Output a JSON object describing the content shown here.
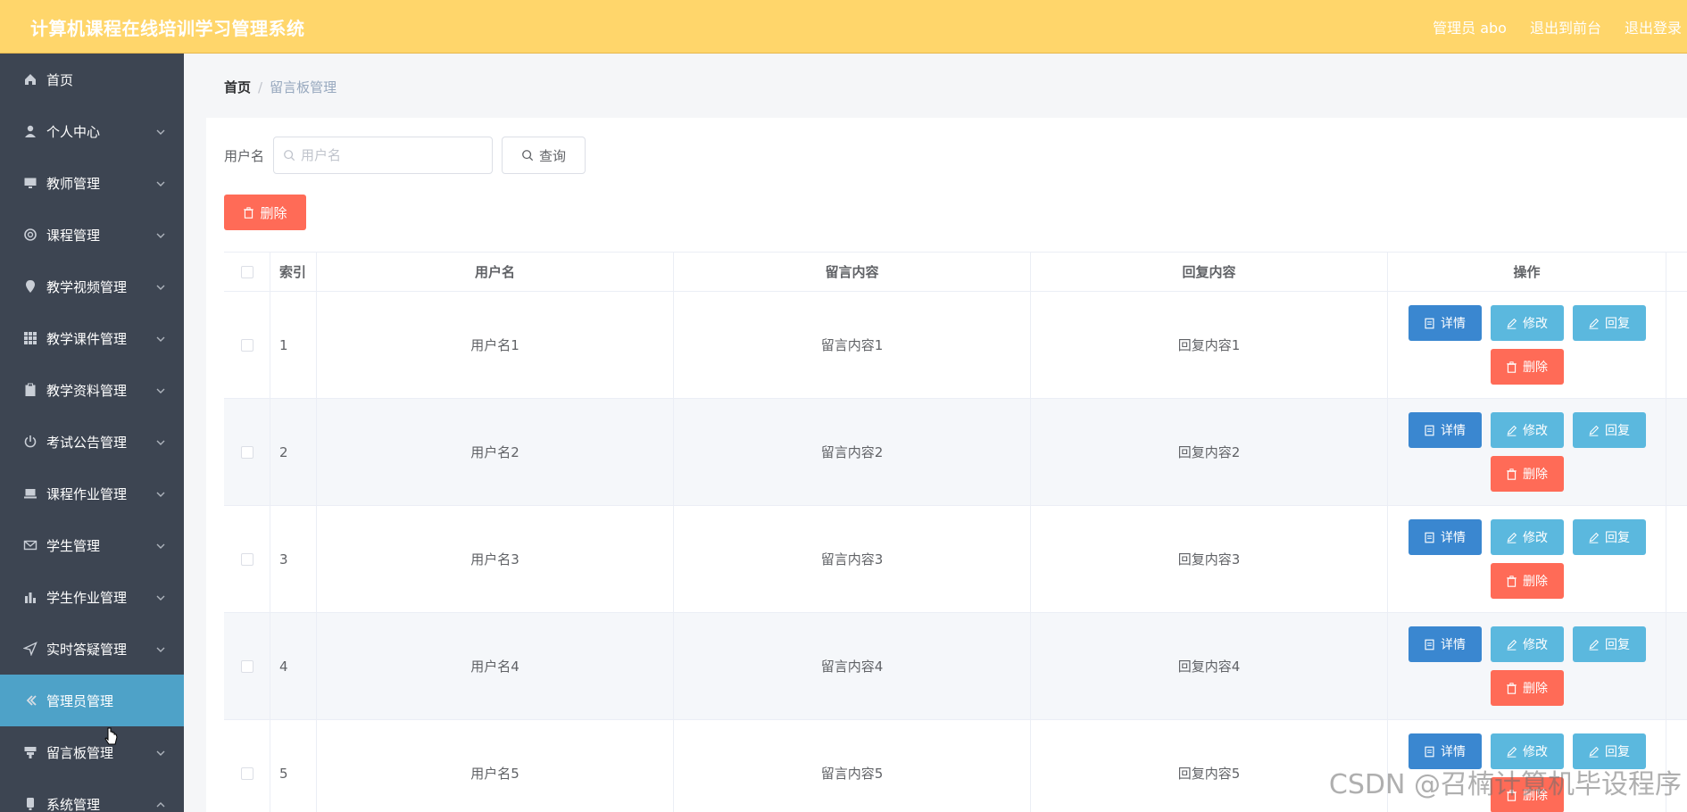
{
  "header": {
    "title": "计算机课程在线培训学习管理系统",
    "admin": "管理员 abo",
    "to_front": "退出到前台",
    "logout": "退出登录"
  },
  "sidebar": {
    "items": [
      {
        "label": "首页",
        "icon": "home-icon"
      },
      {
        "label": "个人中心",
        "icon": "user-icon"
      },
      {
        "label": "教师管理",
        "icon": "monitor-icon"
      },
      {
        "label": "课程管理",
        "icon": "lifebuoy-icon"
      },
      {
        "label": "教学视频管理",
        "icon": "location-icon"
      },
      {
        "label": "教学课件管理",
        "icon": "grid-icon"
      },
      {
        "label": "教学资料管理",
        "icon": "clipboard-icon"
      },
      {
        "label": "考试公告管理",
        "icon": "power-icon"
      },
      {
        "label": "课程作业管理",
        "icon": "laptop-icon"
      },
      {
        "label": "学生管理",
        "icon": "mail-icon"
      },
      {
        "label": "学生作业管理",
        "icon": "bar-chart-icon"
      },
      {
        "label": "实时答疑管理",
        "icon": "send-icon"
      },
      {
        "label": "管理员管理",
        "icon": "back-icon"
      },
      {
        "label": "留言板管理",
        "icon": "box-icon"
      },
      {
        "label": "系统管理",
        "icon": "phone-icon"
      }
    ],
    "active_index": 12
  },
  "breadcrumb": {
    "home": "首页",
    "separator": "/",
    "current": "留言板管理"
  },
  "search": {
    "label": "用户名",
    "placeholder": "用户名",
    "value": "",
    "button": "查询"
  },
  "toolbar": {
    "delete_label": "删除"
  },
  "table": {
    "columns": [
      "索引",
      "用户名",
      "留言内容",
      "回复内容",
      "操作"
    ],
    "rows": [
      {
        "index": "1",
        "user": "用户名1",
        "message": "留言内容1",
        "reply": "回复内容1"
      },
      {
        "index": "2",
        "user": "用户名2",
        "message": "留言内容2",
        "reply": "回复内容2"
      },
      {
        "index": "3",
        "user": "用户名3",
        "message": "留言内容3",
        "reply": "回复内容3"
      },
      {
        "index": "4",
        "user": "用户名4",
        "message": "留言内容4",
        "reply": "回复内容4"
      },
      {
        "index": "5",
        "user": "用户名5",
        "message": "留言内容5",
        "reply": "回复内容5"
      }
    ],
    "actions": {
      "detail": "详情",
      "edit": "修改",
      "reply": "回复",
      "delete": "删除"
    }
  },
  "watermark": "CSDN @召楠计算机毕设程序",
  "colors": {
    "header_bg": "#ffd66b",
    "sidebar_bg": "#3d4552",
    "sidebar_active": "#4ea2c8",
    "danger": "#ff6b57",
    "primary": "#3a87d0",
    "info": "#5bb8de"
  }
}
